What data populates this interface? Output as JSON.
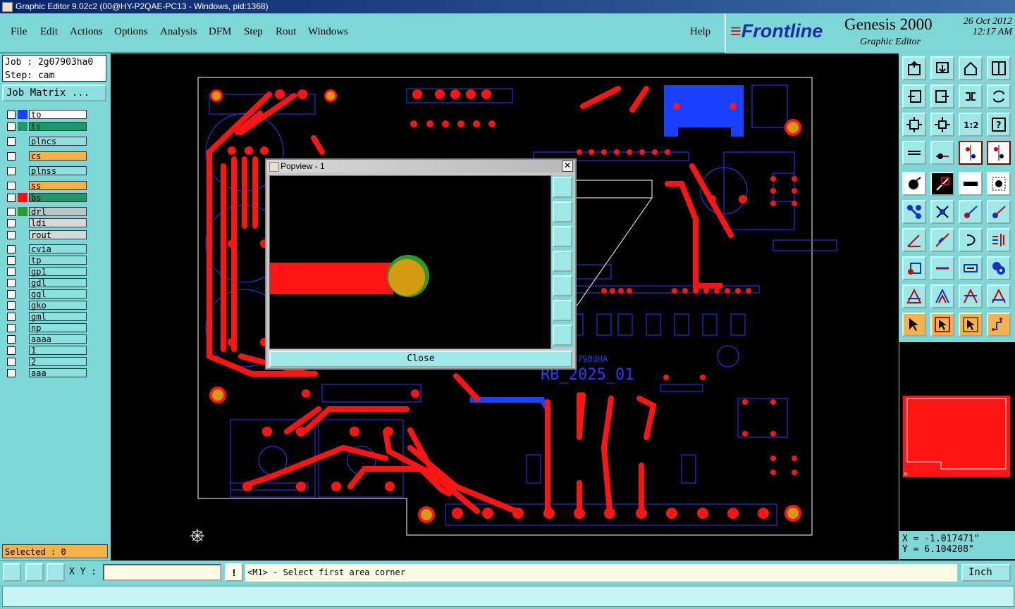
{
  "window": {
    "title": "Graphic Editor 9.02c2 (00@HY-P2QAE-PC13 - Windows, pid:1368)"
  },
  "menu": {
    "items": [
      "File",
      "Edit",
      "Actions",
      "Options",
      "Analysis",
      "DFM",
      "Step",
      "Rout",
      "Windows"
    ],
    "help": "Help"
  },
  "brand": {
    "logo": "Frontline",
    "product": "Genesis 2000",
    "subtitle": "Graphic Editor",
    "date": "26 Oct 2012",
    "time": "12:17 AM"
  },
  "job": {
    "job": "Job : 2g07903ha0",
    "step": "Step: cam",
    "matrix_button": "Job Matrix ..."
  },
  "layers": [
    {
      "name": "to",
      "color": "#1a3cff",
      "bg": "#ffffff"
    },
    {
      "name": "ts",
      "color": "#1a9a6a",
      "bg": "#1a9a6a"
    },
    {
      "name": "plncs",
      "color": "",
      "bg": "#8ee0e0"
    },
    {
      "name": "cs",
      "color": "",
      "bg": "#f5b24a"
    },
    {
      "name": "plnss",
      "color": "",
      "bg": "#8ee0e0"
    },
    {
      "name": "ss",
      "color": "",
      "bg": "#f5b24a"
    },
    {
      "name": "bs",
      "color": "#ff1010",
      "bg": "#1a9a6a"
    },
    {
      "name": "drl",
      "color": "#2a9a2a",
      "bg": "#b8c8c8"
    },
    {
      "name": "ldi",
      "color": "",
      "bg": "#d8d8d8"
    },
    {
      "name": "rout",
      "color": "",
      "bg": "#d8d8d8"
    },
    {
      "name": "cvia",
      "color": "",
      "bg": "#8ee0e0"
    },
    {
      "name": "tp",
      "color": "",
      "bg": "#8ee0e0"
    },
    {
      "name": "gp1",
      "color": "",
      "bg": "#8ee0e0"
    },
    {
      "name": "gdl",
      "color": "",
      "bg": "#8ee0e0"
    },
    {
      "name": "ggl",
      "color": "",
      "bg": "#8ee0e0"
    },
    {
      "name": "gko",
      "color": "",
      "bg": "#8ee0e0"
    },
    {
      "name": "gml",
      "color": "",
      "bg": "#8ee0e0"
    },
    {
      "name": "np",
      "color": "",
      "bg": "#8ee0e0"
    },
    {
      "name": "aaaa",
      "color": "",
      "bg": "#8ee0e0"
    },
    {
      "name": "1",
      "color": "",
      "bg": "#8ee0e0"
    },
    {
      "name": "2",
      "color": "",
      "bg": "#8ee0e0"
    },
    {
      "name": "aaa",
      "color": "",
      "bg": "#8ee0e0"
    }
  ],
  "status": {
    "selected": "Selected : 0",
    "xy_label": "X Y :",
    "xy_value": "",
    "message": "<M1> - Select first area corner",
    "units": "Inch"
  },
  "coords": {
    "x": "X = -1.017471\"",
    "y": "Y = 6.104208\""
  },
  "popup": {
    "title": "Popview - 1",
    "close_x": "✕",
    "close_button": "Close"
  },
  "board": {
    "silk_text_1": "RB_2025_01",
    "silk_text_2": "7903HA"
  },
  "colors": {
    "trace": "#ff1414",
    "pad_fill": "#d49a12",
    "silk": "#2a3aff",
    "canvas": "#000000",
    "panel": "#7ed7d7"
  }
}
